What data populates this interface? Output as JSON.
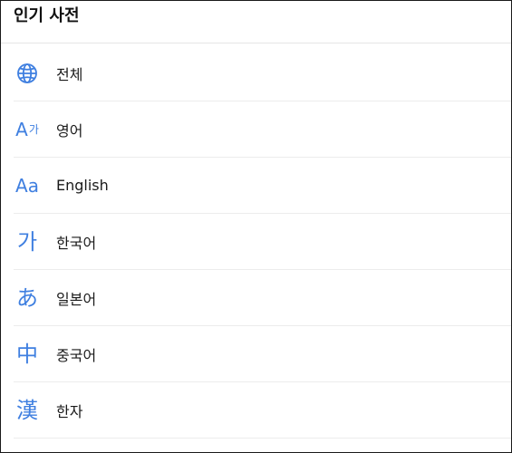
{
  "header": {
    "title": "인기 사전"
  },
  "accent_color": "#3f7fe0",
  "items": [
    {
      "label": "전체",
      "icon": "globe-icon"
    },
    {
      "label": "영어",
      "icon": "a-ga-icon",
      "icon_text_a": "A",
      "icon_text_b": "가"
    },
    {
      "label": "English",
      "icon": "aa-icon",
      "icon_text": "Aa"
    },
    {
      "label": "한국어",
      "icon": "ga-icon",
      "icon_text": "가"
    },
    {
      "label": "일본어",
      "icon": "hiragana-a-icon",
      "icon_text": "あ"
    },
    {
      "label": "중국어",
      "icon": "chinese-zhong-icon",
      "icon_text": "中"
    },
    {
      "label": "한자",
      "icon": "hanja-icon",
      "icon_text": "漢"
    }
  ]
}
